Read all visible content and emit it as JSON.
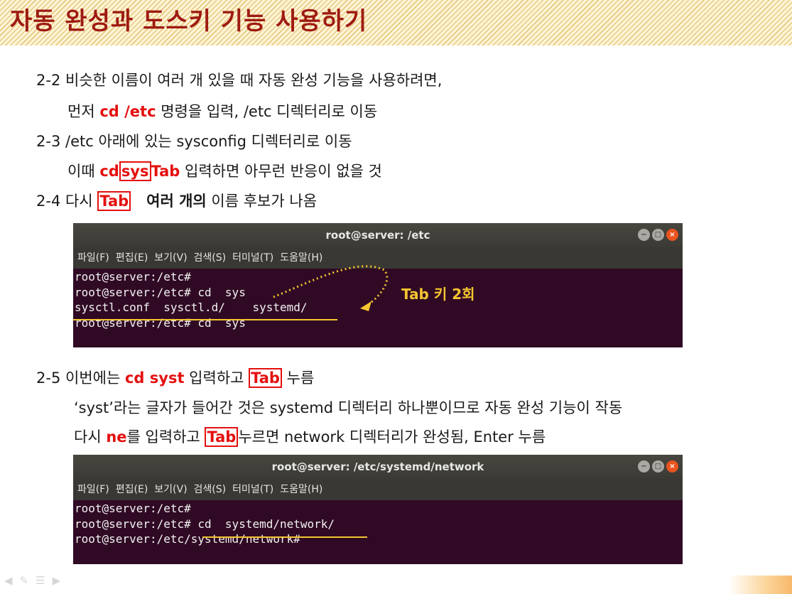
{
  "slide": {
    "title": "자동 완성과 도스키 기능 사용하기"
  },
  "steps": {
    "s2_2": {
      "num": "2-2",
      "text": "비슷한 이름이 여러 개 있을 때 자동 완성 기능을 사용하려면,"
    },
    "s2_2b": {
      "pre": "먼저 ",
      "cmd": "cd /etc",
      "post": " 명령을 입력, /etc 디렉터리로 이동"
    },
    "s2_3": {
      "num": "2-3",
      "text": "/etc 아래에 있는 sysconfig 디렉터리로 이동"
    },
    "s2_3b": {
      "pre": "이때 ",
      "cd": "cd",
      "sys": "sys",
      "tab": "Tab",
      "post": " 입력하면 아무런 반응이 없을 것"
    },
    "s2_4": {
      "num": "2-4",
      "pre": "다시 ",
      "tab": "Tab",
      "bold": "여러 개의",
      "post": " 이름 후보가 나옴"
    },
    "s2_5": {
      "num": "2-5",
      "pre": "이번에는 ",
      "cmd": "cd syst",
      "mid": " 입력하고 ",
      "tab": "Tab",
      "post": " 누름"
    },
    "s2_5b": {
      "text": "‘syst’라는 글자가 들어간 것은 systemd 디렉터리 하나뿐이므로 자동 완성 기능이 작동"
    },
    "s2_5c": {
      "pre": "다시 ",
      "ne": "ne",
      "mid": "를 입력하고 ",
      "tab": "Tab",
      "post": "누르면 network 디렉터리가 완성됨, Enter 누름"
    }
  },
  "terminal1": {
    "title": "root@server: /etc",
    "menu": [
      "파일(F)",
      "편집(E)",
      "보기(V)",
      "검색(S)",
      "터미널(T)",
      "도움말(H)"
    ],
    "lines": [
      "root@server:/etc#",
      "root@server:/etc# cd  sys",
      "sysctl.conf  sysctl.d/    systemd/",
      "root@server:/etc# cd  sys"
    ],
    "callout": "Tab 키 2회"
  },
  "terminal2": {
    "title": "root@server: /etc/systemd/network",
    "menu": [
      "파일(F)",
      "편집(E)",
      "보기(V)",
      "검색(S)",
      "터미널(T)",
      "도움말(H)"
    ],
    "lines": [
      "root@server:/etc#",
      "root@server:/etc# cd  systemd/network/",
      "root@server:/etc/systemd/network#"
    ]
  },
  "nav": {
    "icons": [
      "back-arrow-icon",
      "pen-icon",
      "menu-icon",
      "forward-arrow-icon"
    ]
  },
  "colors": {
    "title": "#9e1b12",
    "highlight": "#e4100f",
    "callout": "#f5c531",
    "terminal_bg": "#300a24"
  }
}
